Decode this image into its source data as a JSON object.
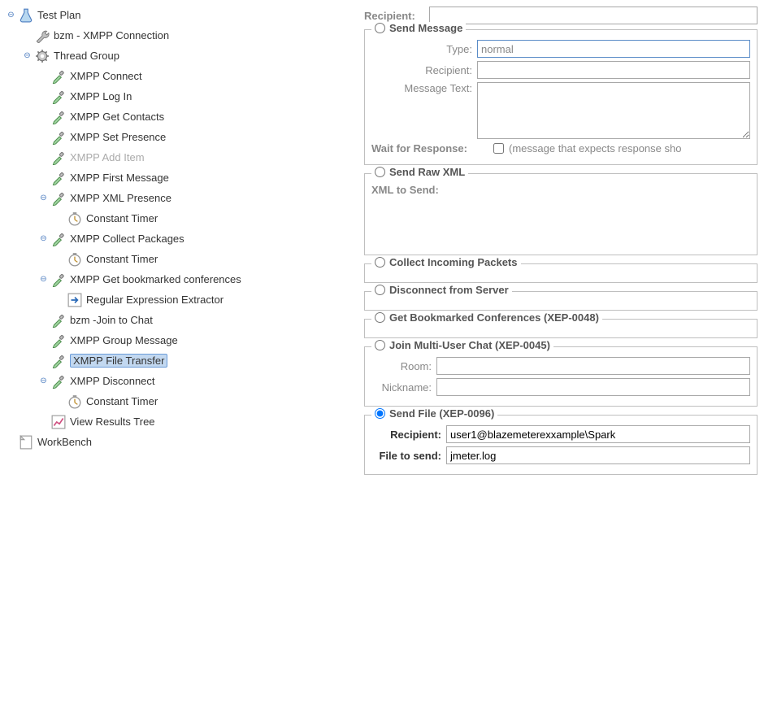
{
  "tree": {
    "testplan": "Test Plan",
    "xmppconn": "bzm - XMPP Connection",
    "threadgroup": "Thread Group",
    "items": {
      "connect": "XMPP Connect",
      "login": "XMPP Log In",
      "getcontacts": "XMPP Get Contacts",
      "setpresence": "XMPP Set Presence",
      "additem": "XMPP Add Item",
      "firstmsg": "XMPP First Message",
      "xmlpresence": "XMPP XML Presence",
      "timer1": "Constant Timer",
      "collectpkg": "XMPP Collect Packages",
      "timer2": "Constant Timer",
      "getbookmarked": "XMPP Get bookmarked conferences",
      "regex": "Regular Expression Extractor",
      "joinchat": "bzm -Join to Chat",
      "groupmsg": "XMPP Group Message",
      "filetransfer": "XMPP File Transfer",
      "disconnect": "XMPP Disconnect",
      "timer3": "Constant Timer",
      "viewresults": "View Results Tree"
    },
    "workbench": "WorkBench"
  },
  "form": {
    "top_recipient_label": "Recipient:",
    "sendmsg": {
      "legend": "Send Message",
      "type_label": "Type:",
      "type_value": "normal",
      "recipient_label": "Recipient:",
      "msgtext_label": "Message Text:",
      "wait_label": "Wait for Response:",
      "wait_hint": "(message that expects response sho"
    },
    "rawxml": {
      "legend": "Send Raw XML",
      "xml_label": "XML to Send:"
    },
    "collect": {
      "legend": "Collect Incoming Packets"
    },
    "disconnect": {
      "legend": "Disconnect from Server"
    },
    "getbook": {
      "legend": "Get Bookmarked Conferences (XEP-0048)"
    },
    "joinmuc": {
      "legend": "Join Multi-User Chat (XEP-0045)",
      "room_label": "Room:",
      "nick_label": "Nickname:"
    },
    "sendfile": {
      "legend": "Send File (XEP-0096)",
      "recipient_label": "Recipient:",
      "recipient_value": "user1@blazemeterexxample\\Spark",
      "file_label": "File to send:",
      "file_value": "jmeter.log"
    }
  }
}
